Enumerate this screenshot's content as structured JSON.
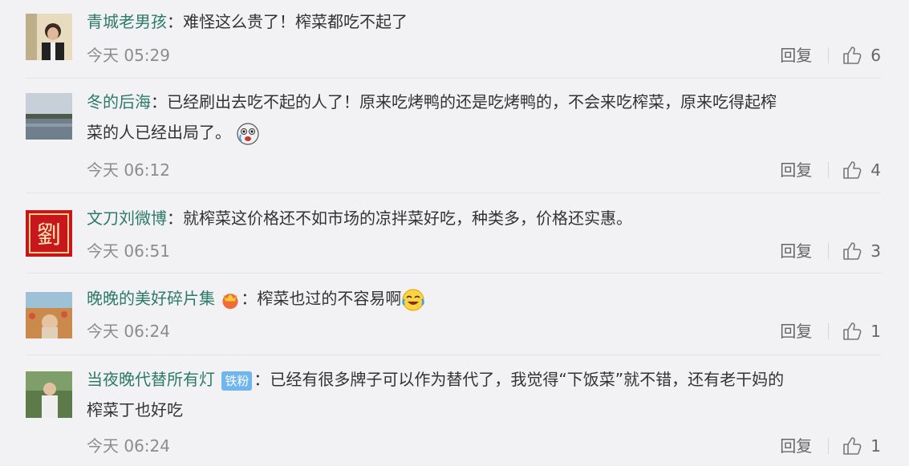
{
  "comments": [
    {
      "username": "青城老男孩",
      "text": "：难怪这么贵了！榨菜都吃不起了",
      "time": "今天 05:29",
      "reply": "回复",
      "likes": "6",
      "avatar": "photo-person"
    },
    {
      "username": "冬的后海",
      "text": "：已经刷出去吃不起的人了！原来吃烤鸭的还是吃烤鸭的，不会来吃榨菜，原来吃得起榨",
      "text2": "菜的人已经出局了。",
      "time": "今天 06:12",
      "reply": "回复",
      "likes": "4",
      "avatar": "photo-lake",
      "emoji": "crying-face-emoji"
    },
    {
      "username": "文刀刘微博",
      "text": "：就榨菜这价格还不如市场的凉拌菜好吃，种类多，价格还实惠。",
      "time": "今天 06:51",
      "reply": "回复",
      "likes": "3",
      "avatar": "red-seal",
      "avatar_char": "劉"
    },
    {
      "username": "晚晚的美好碎片集",
      "text": "：榨菜也过的不容易啊",
      "time": "今天 06:24",
      "reply": "回复",
      "likes": "1",
      "avatar": "photo-field",
      "emoji": "laugh-cry-emoji"
    },
    {
      "username": "当夜晚代替所有灯",
      "badge": "铁粉",
      "text": "：已经有很多牌子可以作为替代了，我觉得“下饭菜”就不错，还有老干妈的",
      "text2": "榨菜丁也好吃",
      "time": "今天 06:24",
      "reply": "回复",
      "likes": "1",
      "avatar": "photo-person-outdoor"
    }
  ],
  "colors": {
    "username": "#2c7a68",
    "background": "#f2f2f5",
    "badge": "#6fb6ee"
  }
}
